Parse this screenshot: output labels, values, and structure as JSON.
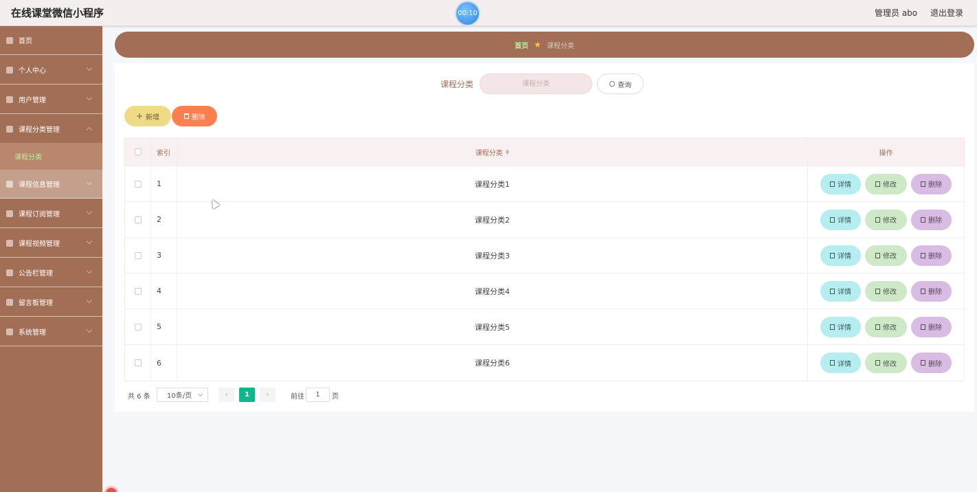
{
  "header": {
    "app_title": "在线课堂微信小程序",
    "timer": "00:10",
    "admin": "管理员 abo",
    "logout": "退出登录"
  },
  "sidebar": {
    "items": [
      {
        "label": "首页",
        "icon": "home-icon"
      },
      {
        "label": "个人中心",
        "icon": "user-icon"
      },
      {
        "label": "用户管理",
        "icon": "grid-icon"
      },
      {
        "label": "课程分类管理",
        "icon": "grid-icon",
        "expanded": true
      },
      {
        "label": "课程信息管理",
        "icon": "book-icon"
      },
      {
        "label": "课程订阅管理",
        "icon": "expand-icon"
      },
      {
        "label": "课程视频管理",
        "icon": "globe-icon"
      },
      {
        "label": "公告栏管理",
        "icon": "list-icon"
      },
      {
        "label": "留言板管理",
        "icon": "expand-icon"
      },
      {
        "label": "系统管理",
        "icon": "gear-icon"
      }
    ],
    "sub_item": "课程分类"
  },
  "breadcrumb": {
    "home": "首页",
    "current": "课程分类"
  },
  "search": {
    "label": "课程分类",
    "placeholder": "课程分类",
    "button": "查询"
  },
  "toolbar": {
    "add": "新增",
    "delete": "删除"
  },
  "table": {
    "headers": {
      "index": "索引",
      "name": "课程分类",
      "ops": "操作"
    },
    "rows": [
      {
        "index": "1",
        "name": "课程分类1"
      },
      {
        "index": "2",
        "name": "课程分类2"
      },
      {
        "index": "3",
        "name": "课程分类3"
      },
      {
        "index": "4",
        "name": "课程分类4"
      },
      {
        "index": "5",
        "name": "课程分类5"
      },
      {
        "index": "6",
        "name": "课程分类6"
      }
    ],
    "ops": {
      "detail": "详情",
      "edit": "修改",
      "delete": "删除"
    }
  },
  "pagination": {
    "total": "共 6 条",
    "page_size": "10条/页",
    "current": "1",
    "goto_label": "前往",
    "goto_value": "1",
    "goto_suffix": "页"
  },
  "colors": {
    "sidebar": "#a26e55",
    "accent_green": "#13b58a",
    "active_text": "#b7f09b"
  }
}
